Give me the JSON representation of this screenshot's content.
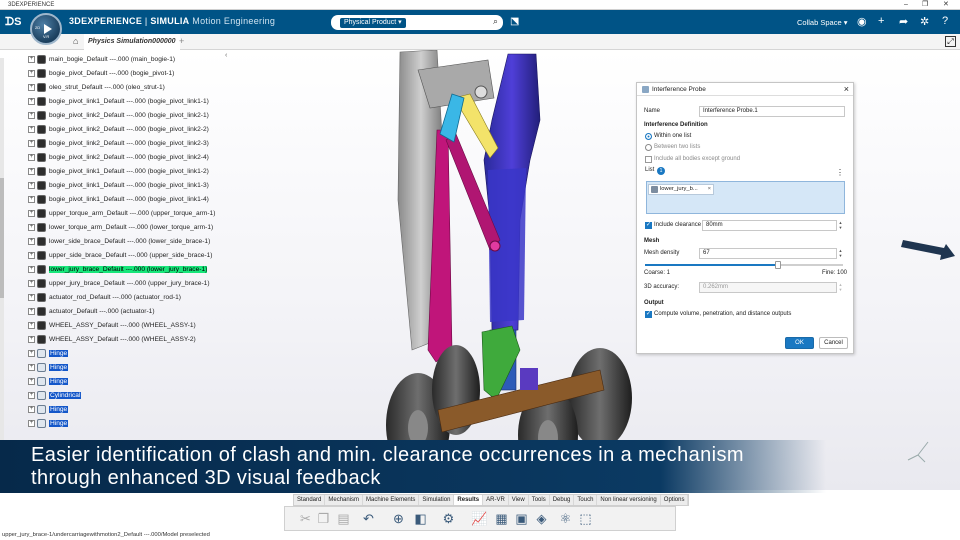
{
  "os_window": {
    "title": "3DEXPERIENCE"
  },
  "header": {
    "brand_bold": "3DEXPERIENCE",
    "brand_sep": " | ",
    "brand_app": "SIMULIA",
    "brand_sub": " Motion Engineering",
    "compass_tl": "2D",
    "compass_bottom": "V.R",
    "search_scope": "Physical Product ▾",
    "collab_space": "Collab Space ▾"
  },
  "tab_bar": {
    "tab_label": "Physics Simulation000000"
  },
  "tree": {
    "items": [
      {
        "label": "main_bogie_Default ---.000 (main_bogie-1)",
        "type": "part"
      },
      {
        "label": "bogie_pivot_Default ---.000 (bogie_pivot-1)",
        "type": "part"
      },
      {
        "label": "oleo_strut_Default ---.000 (oleo_strut-1)",
        "type": "part"
      },
      {
        "label": "bogie_pivot_link1_Default ---.000 (bogie_pivot_link1-1)",
        "type": "part"
      },
      {
        "label": "bogie_pivot_link2_Default ---.000 (bogie_pivot_link2-1)",
        "type": "part"
      },
      {
        "label": "bogie_pivot_link2_Default ---.000 (bogie_pivot_link2-2)",
        "type": "part"
      },
      {
        "label": "bogie_pivot_link2_Default ---.000 (bogie_pivot_link2-3)",
        "type": "part"
      },
      {
        "label": "bogie_pivot_link2_Default ---.000 (bogie_pivot_link2-4)",
        "type": "part"
      },
      {
        "label": "bogie_pivot_link1_Default ---.000 (bogie_pivot_link1-2)",
        "type": "part"
      },
      {
        "label": "bogie_pivot_link1_Default ---.000 (bogie_pivot_link1-3)",
        "type": "part"
      },
      {
        "label": "bogie_pivot_link1_Default ---.000 (bogie_pivot_link1-4)",
        "type": "part"
      },
      {
        "label": "upper_torque_arm_Default ---.000 (upper_torque_arm-1)",
        "type": "part"
      },
      {
        "label": "lower_torque_arm_Default ---.000 (lower_torque_arm-1)",
        "type": "part"
      },
      {
        "label": "lower_side_brace_Default ---.000 (lower_side_brace-1)",
        "type": "part"
      },
      {
        "label": "upper_side_brace_Default ---.000 (upper_side_brace-1)",
        "type": "part"
      },
      {
        "label": "lower_jury_brace_Default ---.000 (lower_jury_brace-1)",
        "type": "part",
        "state": "selected"
      },
      {
        "label": "upper_jury_brace_Default ---.000 (upper_jury_brace-1)",
        "type": "part"
      },
      {
        "label": "actuator_rod_Default ---.000 (actuator_rod-1)",
        "type": "part"
      },
      {
        "label": "actuator_Default ---.000 (actuator-1)",
        "type": "part"
      },
      {
        "label": "WHEEL_ASSY_Default ---.000 (WHEEL_ASSY-1)",
        "type": "part"
      },
      {
        "label": "WHEEL_ASSY_Default ---.000 (WHEEL_ASSY-2)",
        "type": "part"
      },
      {
        "label": "Hinge",
        "type": "joint",
        "state": "highlight"
      },
      {
        "label": "Hinge",
        "type": "joint",
        "state": "highlight"
      },
      {
        "label": "Hinge",
        "type": "joint",
        "state": "highlight"
      },
      {
        "label": "Cylindrical",
        "type": "joint",
        "state": "highlight"
      },
      {
        "label": "Hinge",
        "type": "joint",
        "state": "highlight"
      },
      {
        "label": "Hinge",
        "type": "joint",
        "state": "highlight"
      }
    ]
  },
  "dialog": {
    "title": "Interference Probe",
    "name_label": "Name",
    "name_value": "Interference Probe.1",
    "section_definition": "Interference Definition",
    "opt_within": "Within one list",
    "opt_between": "Between two lists",
    "opt_include_all": "Include all bodies except ground",
    "list_label": "List",
    "list_count": "1",
    "list_item": "lower_jury_b...",
    "include_clearance_label": "Include clearance",
    "clearance_value": "80mm",
    "section_mesh": "Mesh",
    "mesh_density_label": "Mesh density",
    "mesh_density_value": "67",
    "mesh_density_fraction": 0.67,
    "coarse_label": "Coarse: 1",
    "fine_label": "Fine: 100",
    "accuracy_label": "3D accuracy:",
    "accuracy_value": "0.262mm",
    "section_output": "Output",
    "output_label": "Compute volume, penetration, and distance outputs",
    "ok_label": "OK",
    "cancel_label": "Cancel"
  },
  "caption": {
    "line1": "Easier identification of clash and min. clearance occurrences in a mechanism",
    "line2": "through enhanced 3D visual feedback"
  },
  "action_bar": {
    "tabs": [
      "Standard",
      "Mechanism",
      "Machine Elements",
      "Simulation",
      "Results",
      "AR-VR",
      "View",
      "Tools",
      "Debug",
      "Touch",
      "Non linear versioning",
      "Options"
    ],
    "active_tab": "Results"
  },
  "status_bar": {
    "text": "upper_jury_brace-1/undercarriagewithmotion2_Default ---.000/Model preselected"
  },
  "colors": {
    "header": "#005386",
    "accent": "#1a78c2",
    "selected": "#17e67a",
    "highlight": "#1457c9"
  }
}
